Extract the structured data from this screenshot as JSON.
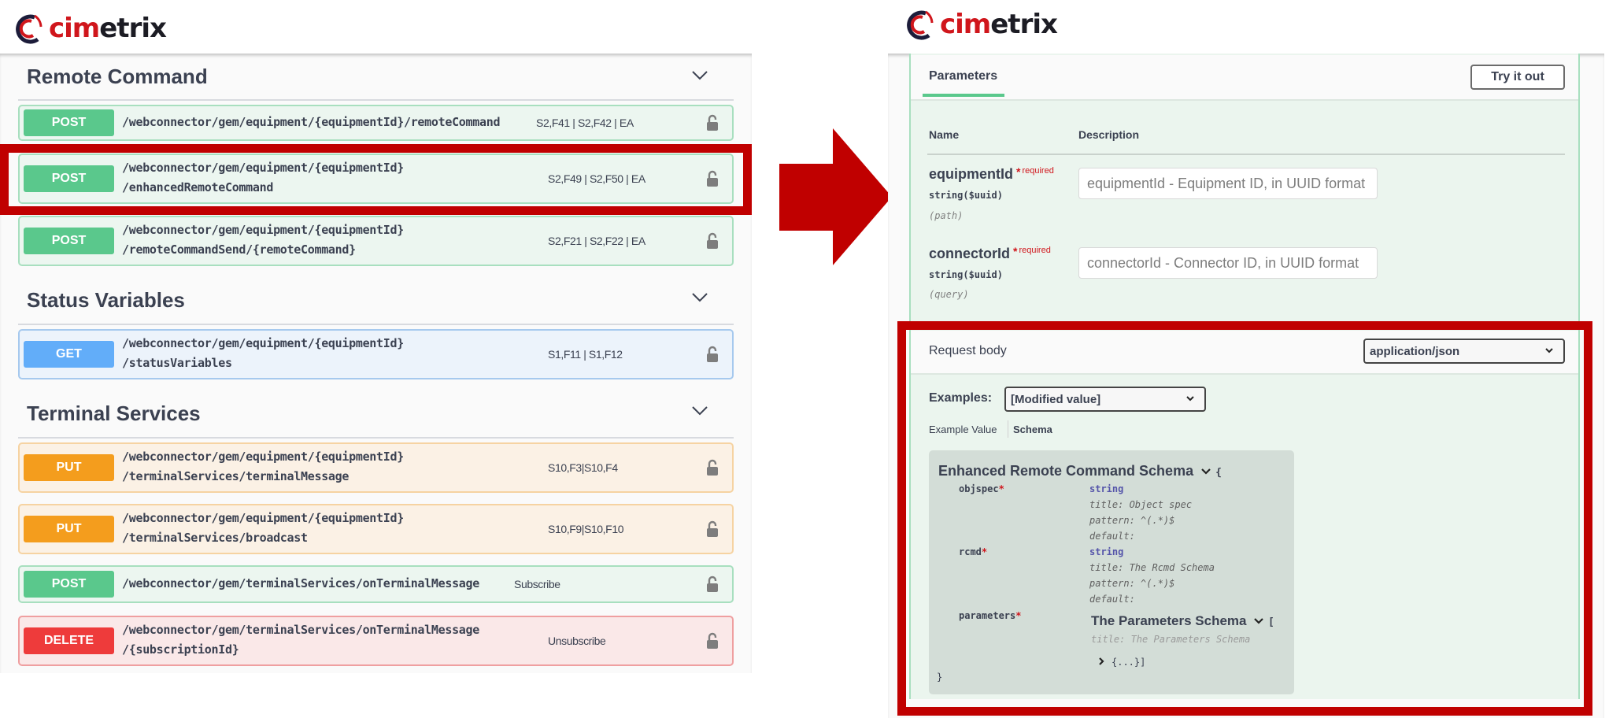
{
  "brand": {
    "logo_prefix": "cim",
    "logo_suffix": "etrix",
    "accent": "#d0161c",
    "highlight": "#c00000"
  },
  "left": {
    "sections": [
      {
        "title": "Remote Command"
      },
      {
        "title": "Status Variables"
      },
      {
        "title": "Terminal Services"
      }
    ],
    "operations": [
      {
        "method": "POST",
        "path1": "/webconnector/gem/equipment/{equipmentId}/remoteCommand",
        "path2": "",
        "summary": "S2,F41 | S2,F42 | EA",
        "locked": true
      },
      {
        "method": "POST",
        "path1": "/webconnector/gem/equipment/{equipmentId}",
        "path2": "/enhancedRemoteCommand",
        "summary": "S2,F49 | S2,F50 | EA",
        "locked": true,
        "highlighted": true
      },
      {
        "method": "POST",
        "path1": "/webconnector/gem/equipment/{equipmentId}",
        "path2": "/remoteCommandSend/{remoteCommand}",
        "summary": "S2,F21 | S2,F22 | EA",
        "locked": true
      },
      {
        "method": "GET",
        "path1": "/webconnector/gem/equipment/{equipmentId}",
        "path2": "/statusVariables",
        "summary": "S1,F11 | S1,F12",
        "locked": true
      },
      {
        "method": "PUT",
        "path1": "/webconnector/gem/equipment/{equipmentId}",
        "path2": "/terminalServices/terminalMessage",
        "summary": "S10,F3|S10,F4",
        "locked": true
      },
      {
        "method": "PUT",
        "path1": "/webconnector/gem/equipment/{equipmentId}",
        "path2": "/terminalServices/broadcast",
        "summary": "S10,F9|S10,F10",
        "locked": true
      },
      {
        "method": "POST",
        "path1": "/webconnector/gem/terminalServices/onTerminalMessage",
        "path2": "",
        "summary": "Subscribe",
        "locked": true
      },
      {
        "method": "DELETE",
        "path1": "/webconnector/gem/terminalServices/onTerminalMessage",
        "path2": "/{subscriptionId}",
        "summary": "Unsubscribe",
        "locked": true
      }
    ]
  },
  "right": {
    "tab": "Parameters",
    "try_button": "Try it out",
    "columns": {
      "name": "Name",
      "description": "Description"
    },
    "params": [
      {
        "name": "equipmentId",
        "star": "*",
        "required": "required",
        "type": "string($uuid)",
        "in": "(path)",
        "placeholder": "equipmentId - Equipment ID, in UUID format"
      },
      {
        "name": "connectorId",
        "star": "*",
        "required": "required",
        "type": "string($uuid)",
        "in": "(query)",
        "placeholder": "connectorId - Connector ID, in UUID format"
      }
    ],
    "request_body": {
      "label": "Request body",
      "content_type": "application/json",
      "examples_label": "Examples:",
      "examples_value": "[Modified value]",
      "tabs": [
        "Example Value",
        "Schema"
      ],
      "schema": {
        "title": "Enhanced Remote Command Schema",
        "open_brace": "{",
        "close_brace": "}",
        "properties": [
          {
            "name": "objspec",
            "type": "string",
            "title": "title: Object spec",
            "pattern": "pattern: ^(.*)$",
            "default": "default:"
          },
          {
            "name": "rcmd",
            "type": "string",
            "title": "title: The Rcmd Schema",
            "pattern": "pattern: ^(.*)$",
            "default": "default:"
          },
          {
            "name": "parameters",
            "schema_title": "The Parameters Schema",
            "open_bracket": "[",
            "title": "title: The Parameters Schema",
            "collapsed": "{...}]"
          }
        ]
      }
    }
  }
}
